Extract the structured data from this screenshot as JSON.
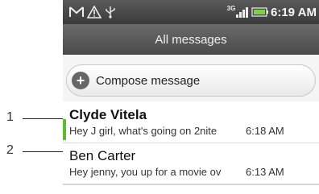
{
  "status_bar": {
    "icons": [
      "gmail-icon",
      "warning-icon",
      "usb-icon",
      "3g-icon",
      "signal-icon",
      "battery-icon"
    ],
    "network_label": "3G",
    "time": "6:19 AM"
  },
  "header": {
    "title": "All messages"
  },
  "compose": {
    "label": "Compose message",
    "icon": "plus-icon"
  },
  "messages": [
    {
      "sender": "Clyde Vitela",
      "preview": "Hey J girl, what's going on 2nite",
      "time": "6:18 AM",
      "unread": true
    },
    {
      "sender": "Ben  Carter",
      "preview": "Hey jenny, you up for a movie ov",
      "time": "6:13 AM",
      "unread": false
    }
  ],
  "callouts": [
    "1",
    "2"
  ],
  "colors": {
    "unread_accent": "#5bbd2e",
    "bar_dark": "#3a3a3a"
  }
}
